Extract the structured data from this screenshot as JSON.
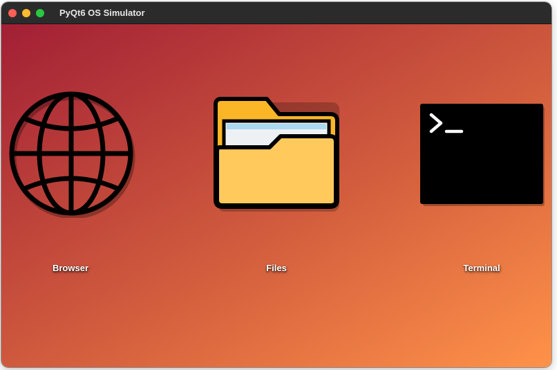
{
  "window": {
    "title": "PyQt6 OS Simulator",
    "controls": {
      "close_color": "#ff5f57",
      "minimize_color": "#febc2e",
      "zoom_color": "#28c840"
    }
  },
  "desktop": {
    "gradient": [
      "#a21f35",
      "#d4603e",
      "#ff9249"
    ],
    "apps": [
      {
        "label": "Browser",
        "icon": "globe-icon"
      },
      {
        "label": "Files",
        "icon": "folder-icon"
      },
      {
        "label": "Terminal",
        "icon": "terminal-icon"
      }
    ]
  }
}
